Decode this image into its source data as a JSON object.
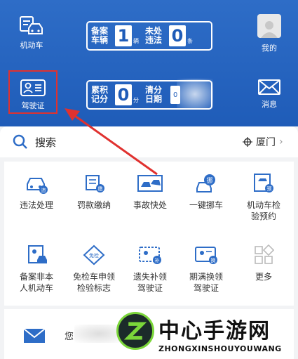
{
  "header": {
    "left_items": [
      {
        "label": "机动车",
        "icon": "car-icon"
      },
      {
        "label": "驾驶证",
        "icon": "license-card-icon"
      }
    ],
    "right_items": [
      {
        "label": "我的",
        "icon": "avatar-icon"
      },
      {
        "label": "消息",
        "icon": "mail-icon"
      }
    ],
    "plate1": {
      "label_line1": "备案",
      "label_line2": "车辆",
      "count": "1",
      "unit": "辆",
      "label2_line1": "未处",
      "label2_line2": "违法",
      "count2": "0",
      "unit2": "条"
    },
    "plate2": {
      "label_line1": "累积",
      "label_line2": "记分",
      "count": "0",
      "unit": "分",
      "label2_line1": "清分",
      "label2_line2": "日期",
      "date_partial": "0"
    }
  },
  "search": {
    "label": "搜索",
    "location": "厦门",
    "chevron": "›"
  },
  "services": [
    {
      "line1": "违法处理",
      "line2": "",
      "icon": "violation-car-icon"
    },
    {
      "line1": "罚款缴纳",
      "line2": "",
      "icon": "fine-scroll-icon"
    },
    {
      "line1": "事故快处",
      "line2": "",
      "icon": "accident-icon"
    },
    {
      "line1": "一键挪车",
      "line2": "",
      "icon": "move-car-icon"
    },
    {
      "line1": "机动车检",
      "line2": "验预约",
      "icon": "inspection-booking-icon"
    },
    {
      "line1": "备案非本",
      "line2": "人机动车",
      "icon": "register-car-icon"
    },
    {
      "line1": "免检车申领",
      "line2": "检验标志",
      "icon": "exempt-badge-icon"
    },
    {
      "line1": "遗失补领",
      "line2": "驾驶证",
      "icon": "lost-license-icon"
    },
    {
      "line1": "期满换领",
      "line2": "驾驶证",
      "icon": "renew-license-icon"
    },
    {
      "line1": "更多",
      "line2": "",
      "icon": "more-grid-icon"
    }
  ],
  "bottom": {
    "text": "您"
  },
  "watermark": {
    "cn": "中心手游网",
    "en": "ZHONGXINSHOUYOUWANG"
  },
  "colors": {
    "header_bg": "#1f5cb8",
    "highlight": "#e0312f",
    "icon_blue": "#2e6dc7"
  }
}
